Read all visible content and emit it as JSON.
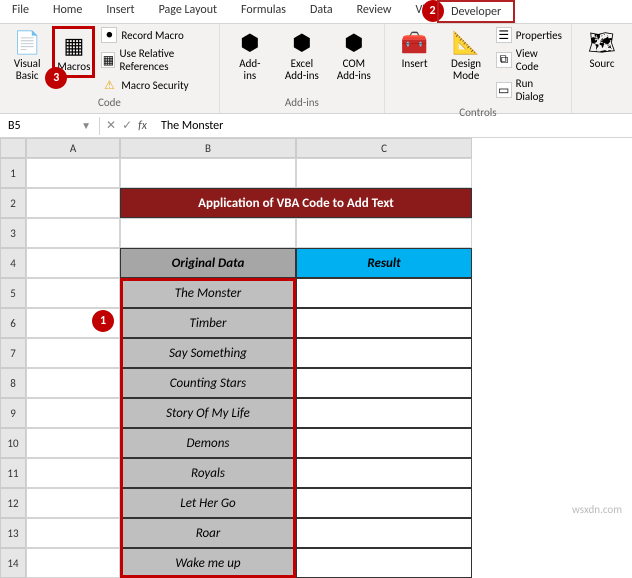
{
  "tabs": {
    "file": "File",
    "home": "Home",
    "insert": "Insert",
    "page_layout": "Page Layout",
    "formulas": "Formulas",
    "data": "Data",
    "review": "Review",
    "view_prefix": "Vi",
    "developer": "Developer"
  },
  "callouts": {
    "c1": "1",
    "c2": "2",
    "c3": "3"
  },
  "ribbon": {
    "code": {
      "visual_basic": "Visual\nBasic",
      "macros": "Macros",
      "record_macro": "Record Macro",
      "use_rel_refs": "Use Relative References",
      "macro_security": "Macro Security",
      "group": "Code"
    },
    "addins": {
      "addins": "Add-\nins",
      "excel_addins": "Excel\nAdd-ins",
      "com_addins": "COM\nAdd-ins",
      "group": "Add-ins"
    },
    "controls": {
      "insert": "Insert",
      "design_mode": "Design\nMode",
      "properties": "Properties",
      "view_code": "View Code",
      "run_dialog": "Run Dialog",
      "group": "Controls"
    },
    "source": {
      "label": "Sourc"
    }
  },
  "namebox": {
    "ref": "B5"
  },
  "formula_bar": {
    "fx": "fx",
    "value": "The Monster"
  },
  "columns": {
    "A": "A",
    "B": "B",
    "C": "C"
  },
  "rows": [
    "1",
    "2",
    "3",
    "4",
    "5",
    "6",
    "7",
    "8",
    "9",
    "10",
    "11",
    "12",
    "13",
    "14"
  ],
  "title_row": "Application of VBA Code to Add Text",
  "headers": {
    "col_b": "Original Data",
    "col_c": "Result"
  },
  "data_b": [
    "The Monster",
    "Timber",
    "Say Something",
    "Counting Stars",
    "Story Of My Life",
    "Demons",
    "Royals",
    "Let Her Go",
    "Roar",
    "Wake me up"
  ],
  "watermark": "wsxdn.com",
  "chart_data": {
    "type": "table",
    "title": "Application of VBA Code to Add Text",
    "columns": [
      "Original Data",
      "Result"
    ],
    "rows": [
      [
        "The Monster",
        ""
      ],
      [
        "Timber",
        ""
      ],
      [
        "Say Something",
        ""
      ],
      [
        "Counting Stars",
        ""
      ],
      [
        "Story Of My Life",
        ""
      ],
      [
        "Demons",
        ""
      ],
      [
        "Royals",
        ""
      ],
      [
        "Let Her Go",
        ""
      ],
      [
        "Roar",
        ""
      ],
      [
        "Wake me up",
        ""
      ]
    ]
  }
}
